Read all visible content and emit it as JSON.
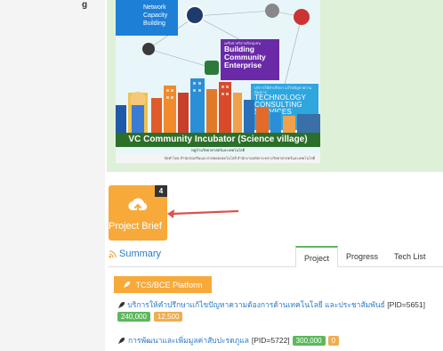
{
  "rail": {
    "fragment": "g"
  },
  "poster": {
    "network_lines": [
      "Network",
      "Capacity",
      "Building"
    ],
    "bce_small": "เครือข่ายวิสาหกิจชุมชน",
    "bce_title_lines": [
      "Building",
      "Community",
      "Enterprise"
    ],
    "tcs_small": "บริการให้คำปรึกษา แก้ไขปัญหาความต้องการ",
    "tcs_title_lines": [
      "TECHNOLOGY",
      "CONSULTING",
      "SERVICES"
    ],
    "band_title": "VC Community Incubator (Science village)",
    "band_sub": "หมู่บ้านวิทยาศาสตร์และเทคโนโลยี",
    "footer": "จัดทำโดย สำนักส่งเสริมและถ่ายทอดเทคโนโลยี สำนักงานปลัดกระทรวงวิทยาศาสตร์และเทคโนโลยี"
  },
  "tile": {
    "badge": "4",
    "label": "Project Brief"
  },
  "summary": {
    "title": "Summary"
  },
  "tabs": [
    {
      "label": "Project",
      "active": true
    },
    {
      "label": "Progress",
      "active": false
    },
    {
      "label": "Tech List",
      "active": false
    }
  ],
  "platform_button": {
    "label": "TCS/BCE Platform"
  },
  "projects": [
    {
      "title": "บริการให้คำปรึกษาแก้ไขปัญหาความต้องการด้านเทคโนโลยี และประชาสัมพันธ์",
      "pid": "[PID=5651]",
      "value_green": "240,000",
      "value_orange": "12,500"
    },
    {
      "title": "การพัฒนาและเพิ่มมูลค่าสับปะรดภูแล",
      "pid": "[PID=5722]",
      "value_green": "300,000",
      "value_orange": "0"
    }
  ],
  "colors": {
    "accent_orange": "#f7a93a",
    "link_blue": "#2a7bc4",
    "green_pill": "#5cb85c",
    "green_panel": "#dff0d8",
    "arrow_red": "#d9534f"
  }
}
